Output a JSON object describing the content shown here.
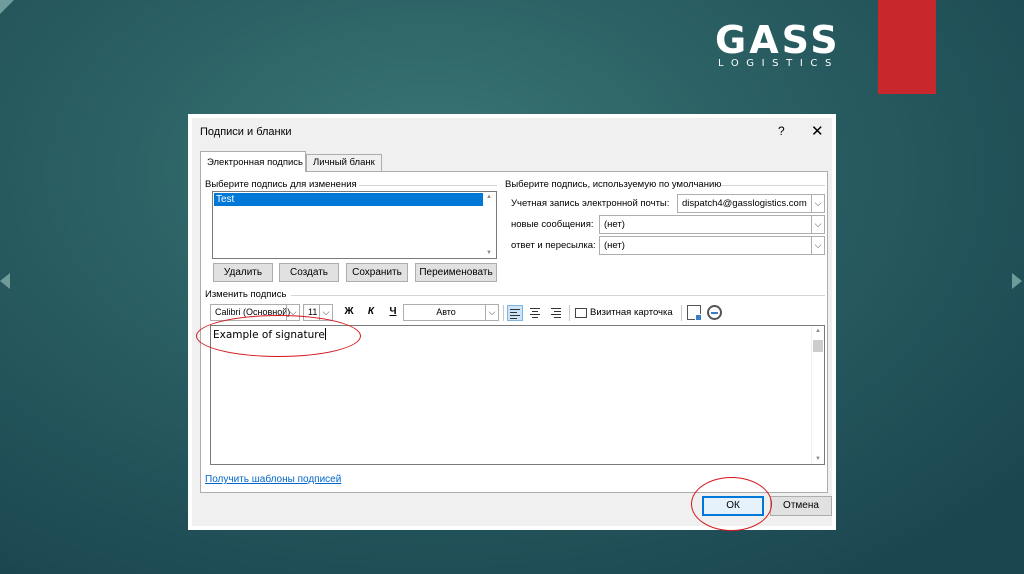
{
  "brand": {
    "name": "GASS",
    "tagline": "LOGISTICS"
  },
  "dialog": {
    "title": "Подписи и бланки",
    "help": "?",
    "close": "✕",
    "tabs": [
      "Электронная подпись",
      "Личный бланк"
    ],
    "select_group_label": "Выберите подпись для изменения",
    "signature_list": [
      "Test"
    ],
    "list_buttons": {
      "delete": "Удалить",
      "create": "Создать",
      "save": "Сохранить",
      "rename": "Переименовать"
    },
    "default_group_label": "Выберите подпись, используемую по умолчанию",
    "default_fields": {
      "account_label": "Учетная запись электронной почты:",
      "account_value": "dispatch4@gasslogistics.com",
      "new_messages_label": "новые сообщения:",
      "new_messages_value": "(нет)",
      "reply_label": "ответ и пересылка:",
      "reply_value": "(нет)"
    },
    "edit_group_label": "Изменить подпись",
    "toolbar": {
      "font": "Calibri (Основной)",
      "size": "11",
      "bold": "Ж",
      "italic": "К",
      "underline": "Ч",
      "color": "Авто",
      "business_card": "Визитная карточка"
    },
    "editor_text": "Example of signature",
    "templates_link": "Получить шаблоны подписей",
    "ok": "ОК",
    "cancel": "Отмена"
  },
  "colors": {
    "accent": "#0078d7",
    "annotation": "#d4171c",
    "brand_red": "#c8272c",
    "background": "#2a5f63"
  }
}
